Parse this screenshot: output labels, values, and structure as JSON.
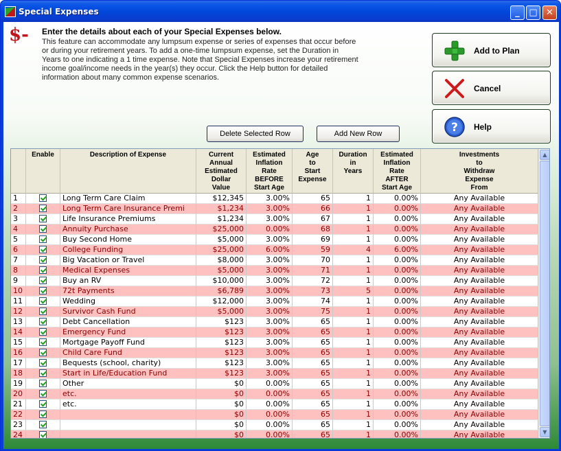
{
  "window": {
    "title": "Special Expenses"
  },
  "logo_text": "$-",
  "intro": {
    "heading": "Enter the details about each of your Special Expenses below.",
    "lines": [
      "This feature can accommodate any lumpsum expense or series of expenses that occur before",
      "or during your retirement years.  To add a one-time lumpsum expense, set the Duration in",
      "Years to one indicating a 1 time expense.  Note that Special Expenses increase your retirement",
      "income goal/income needs in the year(s) they occur.  Click the Help button for detailed",
      "information about many common expense scenarios."
    ]
  },
  "buttons": {
    "add": "Add to Plan",
    "cancel": "Cancel",
    "help": "Help",
    "delete_row": "Delete Selected Row",
    "add_row": "Add New Row"
  },
  "columns": [
    [
      "",
      ""
    ],
    [
      "Enable"
    ],
    [
      "Description of Expense"
    ],
    [
      "Current",
      "Annual",
      "Estimated",
      "Dollar",
      "Value"
    ],
    [
      "Estimated",
      "Inflation",
      "Rate",
      "BEFORE",
      "Start Age"
    ],
    [
      "Age",
      "to",
      "Start",
      "Expense"
    ],
    [
      "Duration",
      "in",
      "Years"
    ],
    [
      "Estimated",
      "Inflation",
      "Rate",
      "AFTER",
      "Start Age"
    ],
    [
      "Investments",
      "to",
      "Withdraw",
      "Expense",
      "From"
    ]
  ],
  "rows": [
    [
      "1",
      "Long Term Care Claim",
      "$12,345",
      "3.00%",
      "65",
      "1",
      "0.00%",
      "Any Available"
    ],
    [
      "2",
      "Long Term Care Insurance Premi",
      "$1,234",
      "3.00%",
      "66",
      "1",
      "0.00%",
      "Any Available"
    ],
    [
      "3",
      "Life Insurance Premiums",
      "$1,234",
      "3.00%",
      "67",
      "1",
      "0.00%",
      "Any Available"
    ],
    [
      "4",
      "Annuity Purchase",
      "$25,000",
      "0.00%",
      "68",
      "1",
      "0.00%",
      "Any Available"
    ],
    [
      "5",
      "Buy Second Home",
      "$5,000",
      "3.00%",
      "69",
      "1",
      "0.00%",
      "Any Available"
    ],
    [
      "6",
      "College Funding",
      "$25,000",
      "6.00%",
      "59",
      "4",
      "6.00%",
      "Any Available"
    ],
    [
      "7",
      "Big Vacation or Travel",
      "$8,000",
      "3.00%",
      "70",
      "1",
      "0.00%",
      "Any Available"
    ],
    [
      "8",
      "Medical Expenses",
      "$5,000",
      "3.00%",
      "71",
      "1",
      "0.00%",
      "Any Available"
    ],
    [
      "9",
      "Buy an RV",
      "$10,000",
      "3.00%",
      "72",
      "1",
      "0.00%",
      "Any Available"
    ],
    [
      "10",
      "72t Payments",
      "$6,789",
      "3.00%",
      "73",
      "5",
      "0.00%",
      "Any Available"
    ],
    [
      "11",
      "Wedding",
      "$12,000",
      "3.00%",
      "74",
      "1",
      "0.00%",
      "Any Available"
    ],
    [
      "12",
      "Survivor Cash Fund",
      "$5,000",
      "3.00%",
      "75",
      "1",
      "0.00%",
      "Any Available"
    ],
    [
      "13",
      "Debt Cancellation",
      "$123",
      "3.00%",
      "65",
      "1",
      "0.00%",
      "Any Available"
    ],
    [
      "14",
      "Emergency Fund",
      "$123",
      "3.00%",
      "65",
      "1",
      "0.00%",
      "Any Available"
    ],
    [
      "15",
      "Mortgage Payoff Fund",
      "$123",
      "3.00%",
      "65",
      "1",
      "0.00%",
      "Any Available"
    ],
    [
      "16",
      "Child Care Fund",
      "$123",
      "3.00%",
      "65",
      "1",
      "0.00%",
      "Any Available"
    ],
    [
      "17",
      "Bequests (school, charity)",
      "$123",
      "3.00%",
      "65",
      "1",
      "0.00%",
      "Any Available"
    ],
    [
      "18",
      "Start in Life/Education Fund",
      "$123",
      "3.00%",
      "65",
      "1",
      "0.00%",
      "Any Available"
    ],
    [
      "19",
      "Other",
      "$0",
      "0.00%",
      "65",
      "1",
      "0.00%",
      "Any Available"
    ],
    [
      "20",
      "etc.",
      "$0",
      "0.00%",
      "65",
      "1",
      "0.00%",
      "Any Available"
    ],
    [
      "21",
      "etc.",
      "$0",
      "0.00%",
      "65",
      "1",
      "0.00%",
      "Any Available"
    ],
    [
      "22",
      "",
      "$0",
      "0.00%",
      "65",
      "1",
      "0.00%",
      "Any Available"
    ],
    [
      "23",
      "",
      "$0",
      "0.00%",
      "65",
      "1",
      "0.00%",
      "Any Available"
    ],
    [
      "24",
      "",
      "$0",
      "0.00%",
      "65",
      "1",
      "0.00%",
      "Any Available"
    ]
  ]
}
